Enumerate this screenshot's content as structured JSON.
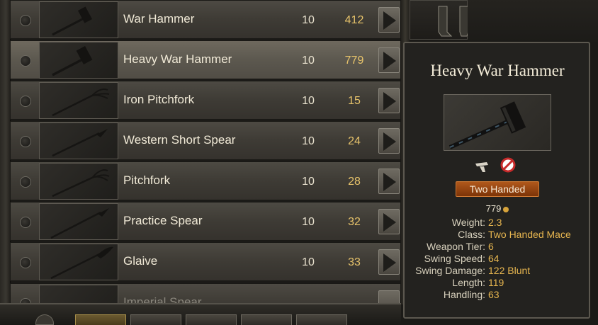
{
  "items": [
    {
      "name": "War Hammer",
      "qty": "10",
      "price": "412",
      "icon": "hammer-icon",
      "selected": false
    },
    {
      "name": "Heavy War Hammer",
      "qty": "10",
      "price": "779",
      "icon": "hammer-icon",
      "selected": true
    },
    {
      "name": "Iron Pitchfork",
      "qty": "10",
      "price": "15",
      "icon": "pitchfork-icon",
      "selected": false
    },
    {
      "name": "Western Short Spear",
      "qty": "10",
      "price": "24",
      "icon": "spear-icon",
      "selected": false
    },
    {
      "name": "Pitchfork",
      "qty": "10",
      "price": "28",
      "icon": "pitchfork-icon",
      "selected": false
    },
    {
      "name": "Practice Spear",
      "qty": "10",
      "price": "32",
      "icon": "spear-icon",
      "selected": false
    },
    {
      "name": "Glaive",
      "qty": "10",
      "price": "33",
      "icon": "glaive-icon",
      "selected": false
    }
  ],
  "partial_item": {
    "name": "Imperial Spear"
  },
  "tooltip": {
    "title": "Heavy War Hammer",
    "class_badge": "Two Handed",
    "price": "779",
    "stats": [
      {
        "label": "Weight:",
        "value": "2.3"
      },
      {
        "label": "Class:",
        "value": "Two Handed Mace"
      },
      {
        "label": "Weapon Tier:",
        "value": "6"
      },
      {
        "label": "Swing Speed:",
        "value": "64"
      },
      {
        "label": "Swing Damage:",
        "value": "122 Blunt"
      },
      {
        "label": "Length:",
        "value": "119"
      },
      {
        "label": "Handling:",
        "value": "63"
      }
    ]
  },
  "colors": {
    "accent_gold": "#e6b54f",
    "badge_orange": "#b0581b",
    "row_bg": "#3e3b35",
    "row_selected_bg": "#5c584f"
  }
}
